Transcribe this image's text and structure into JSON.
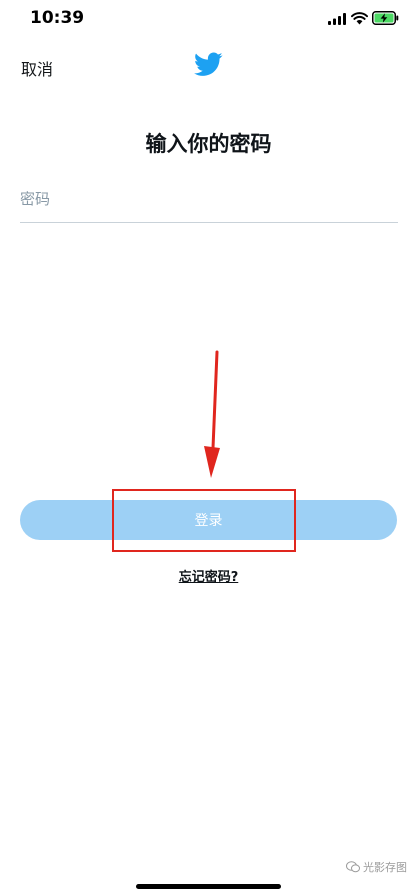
{
  "status_bar": {
    "time": "10:39",
    "icons": [
      "signal-icon",
      "wifi-icon",
      "battery-charging-icon"
    ]
  },
  "header": {
    "cancel_label": "取消",
    "logo_icon": "twitter-bird-icon",
    "brand_color": "#1da1f2"
  },
  "main": {
    "title": "输入你的密码",
    "password_placeholder": "密码",
    "login_label": "登录",
    "login_color": "#9dd0f5",
    "forgot_label": "忘记密码?"
  },
  "annotation": {
    "arrow_color": "#e0261e",
    "box_color": "#e0261e"
  },
  "watermark": {
    "text": "光影存图"
  }
}
